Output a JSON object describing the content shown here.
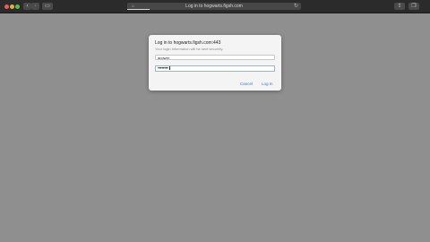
{
  "browser": {
    "address_text": "Log in to hogwarts.figsh.com",
    "load_progress": 0.13,
    "reload_icon": "↻",
    "lock_icon": "⌂",
    "back_icon": "‹",
    "forward_icon": "›",
    "sidebar_icon": "▭",
    "share_icon": "⇪",
    "tabs_icon": "❐"
  },
  "dialog": {
    "title": "Log in to hogwarts.figsh.com:443",
    "subtitle": "Your login information will be sent securely.",
    "username_value": "gpower",
    "password_mask": "••••••••",
    "cancel_label": "Cancel",
    "login_label": "Log In"
  },
  "colors": {
    "background": "#8f8f8f",
    "toolbar": "#2b2b2b",
    "accent": "#3a7bd5"
  }
}
